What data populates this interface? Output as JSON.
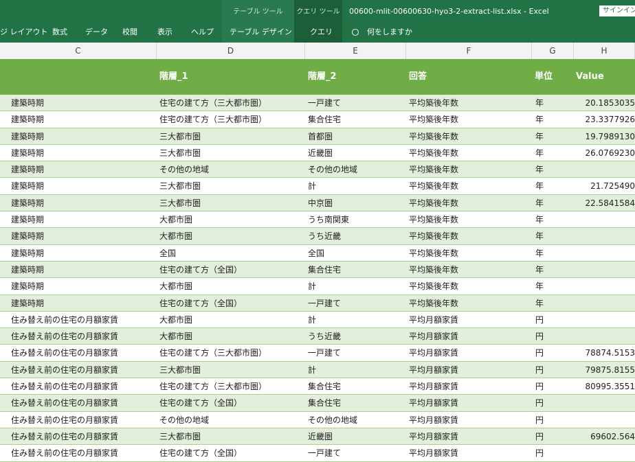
{
  "ribbon": {
    "context_table": "テーブル ツール",
    "context_query": "クエリ ツール",
    "title": "00600-mlit-00600630-hyo3-2-extract-list.xlsx  -  Excel",
    "signin": "サインイン",
    "tabs": [
      "ジ レイアウト",
      "数式",
      "データ",
      "校閲",
      "表示",
      "ヘルプ",
      "テーブル デザイン",
      "クエリ"
    ],
    "tell_me": "何をしますか"
  },
  "columns": [
    "C",
    "D",
    "E",
    "F",
    "G",
    "H"
  ],
  "table": {
    "headers": [
      "",
      "階層_1",
      "階層_2",
      "回答",
      "単位",
      "Value"
    ],
    "rows": [
      [
        "建築時期",
        "住宅の建て方（三大都市圏）",
        "一戸建て",
        "平均築後年数",
        "年",
        "20.1853035"
      ],
      [
        "建築時期",
        "住宅の建て方（三大都市圏）",
        "集合住宅",
        "平均築後年数",
        "年",
        "23.3377926"
      ],
      [
        "建築時期",
        "三大都市圏",
        "首都圏",
        "平均築後年数",
        "年",
        "19.7989130"
      ],
      [
        "建築時期",
        "三大都市圏",
        "近畿圏",
        "平均築後年数",
        "年",
        "26.0769230"
      ],
      [
        "建築時期",
        "その他の地域",
        "その他の地域",
        "平均築後年数",
        "年",
        ""
      ],
      [
        "建築時期",
        "三大都市圏",
        "計",
        "平均築後年数",
        "年",
        "21.725490"
      ],
      [
        "建築時期",
        "三大都市圏",
        "中京圏",
        "平均築後年数",
        "年",
        "22.5841584"
      ],
      [
        "建築時期",
        "大都市圏",
        "うち南関東",
        "平均築後年数",
        "年",
        ""
      ],
      [
        "建築時期",
        "大都市圏",
        "うち近畿",
        "平均築後年数",
        "年",
        ""
      ],
      [
        "建築時期",
        "全国",
        "全国",
        "平均築後年数",
        "年",
        ""
      ],
      [
        "建築時期",
        "住宅の建て方（全国）",
        "集合住宅",
        "平均築後年数",
        "年",
        ""
      ],
      [
        "建築時期",
        "大都市圏",
        "計",
        "平均築後年数",
        "年",
        ""
      ],
      [
        "建築時期",
        "住宅の建て方（全国）",
        "一戸建て",
        "平均築後年数",
        "年",
        ""
      ],
      [
        "住み替え前の住宅の月額家賃",
        "大都市圏",
        "計",
        "平均月額家賃",
        "円",
        ""
      ],
      [
        "住み替え前の住宅の月額家賃",
        "大都市圏",
        "うち近畿",
        "平均月額家賃",
        "円",
        ""
      ],
      [
        "住み替え前の住宅の月額家賃",
        "住宅の建て方（三大都市圏）",
        "一戸建て",
        "平均月額家賃",
        "円",
        "78874.5153"
      ],
      [
        "住み替え前の住宅の月額家賃",
        "三大都市圏",
        "計",
        "平均月額家賃",
        "円",
        "79875.8155"
      ],
      [
        "住み替え前の住宅の月額家賃",
        "住宅の建て方（三大都市圏）",
        "集合住宅",
        "平均月額家賃",
        "円",
        "80995.3551"
      ],
      [
        "住み替え前の住宅の月額家賃",
        "住宅の建て方（全国）",
        "集合住宅",
        "平均月額家賃",
        "円",
        ""
      ],
      [
        "住み替え前の住宅の月額家賃",
        "その他の地域",
        "その他の地域",
        "平均月額家賃",
        "円",
        ""
      ],
      [
        "住み替え前の住宅の月額家賃",
        "三大都市圏",
        "近畿圏",
        "平均月額家賃",
        "円",
        "69602.564"
      ],
      [
        "住み替え前の住宅の月額家賃",
        "住宅の建て方（全国）",
        "一戸建て",
        "平均月額家賃",
        "円",
        ""
      ]
    ]
  },
  "colors": {
    "ribbon": "#217346",
    "header_fill": "#70ad47",
    "band_fill": "#e2efda",
    "row_border": "#a9d08e"
  }
}
